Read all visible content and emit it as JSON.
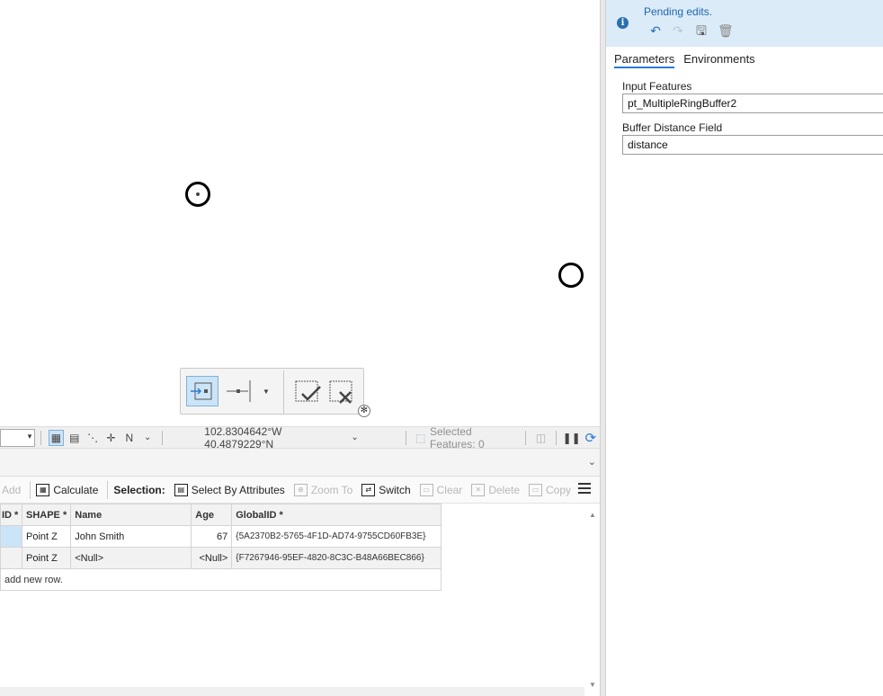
{
  "status_bar": {
    "coordinates": "102.8304642°W 40.4879229°N",
    "selected_features": "Selected Features: 0"
  },
  "table": {
    "toolbar": {
      "add": "Add",
      "calculate": "Calculate",
      "selection": "Selection:",
      "select_by_attributes": "Select By Attributes",
      "zoom_to": "Zoom To",
      "switch": "Switch",
      "clear": "Clear",
      "delete": "Delete",
      "copy": "Copy"
    },
    "columns": [
      "ID *",
      "SHAPE *",
      "Name",
      "Age",
      "GlobalID *"
    ],
    "rows": [
      {
        "shape": "Point Z",
        "name": "John Smith",
        "age": "67",
        "globalid": "{5A2370B2-5765-4F1D-AD74-9755CD60FB3E}"
      },
      {
        "shape": "Point Z",
        "name": "<Null>",
        "age": "<Null>",
        "globalid": "{F7267946-95EF-4820-8C3C-B48A66BEC866}"
      }
    ],
    "add_row_hint": "add new row."
  },
  "geoprocessing": {
    "message": "Pending edits.",
    "tabs": [
      "Parameters",
      "Environments"
    ],
    "input_features_label": "Input Features",
    "input_features_value": "pt_MultipleRingBuffer2",
    "buffer_distance_label": "Buffer Distance Field",
    "buffer_distance_value": "distance"
  },
  "colors": {
    "accent": "#2a7bd2",
    "banner": "#dcebf8",
    "selected_row": "#cce4f7"
  }
}
